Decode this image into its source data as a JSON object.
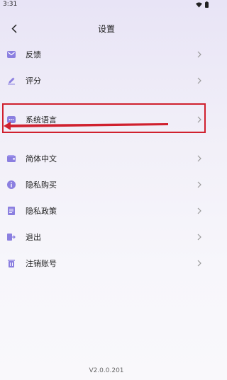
{
  "status": {
    "time": "3:31"
  },
  "header": {
    "title": "设置"
  },
  "menu": {
    "group1": [
      {
        "label": "反馈",
        "icon": "mail-icon"
      },
      {
        "label": "评分",
        "icon": "pencil-icon"
      }
    ],
    "group2": [
      {
        "label": "系统语言",
        "icon": "chat-dots-icon"
      }
    ],
    "group3": [
      {
        "label": "简体中文",
        "icon": "wallet-icon"
      },
      {
        "label": "隐私购买",
        "icon": "info-icon"
      },
      {
        "label": "隐私政策",
        "icon": "document-icon"
      },
      {
        "label": "退出",
        "icon": "logout-icon"
      },
      {
        "label": "注销账号",
        "icon": "trash-icon"
      }
    ]
  },
  "version": "V2.0.0.201",
  "colors": {
    "accent": "#8b7fe0",
    "annotation": "#d0202e"
  }
}
